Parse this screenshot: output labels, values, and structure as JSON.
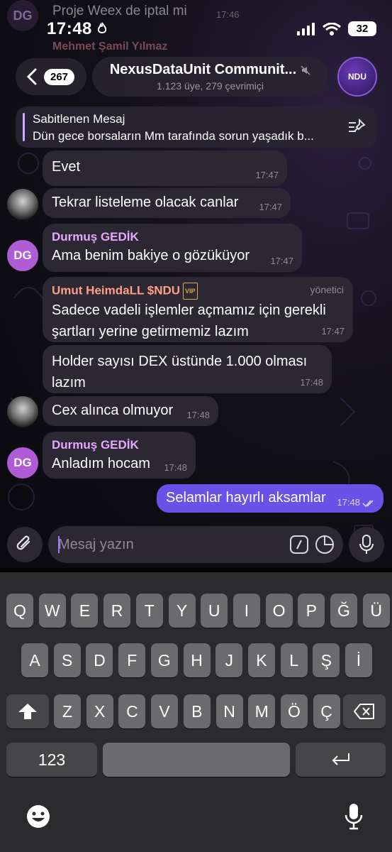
{
  "status_bar": {
    "time": "17:48",
    "battery": "32"
  },
  "peek": {
    "avatar": "DG",
    "text": "Proje Weex de iptal mi",
    "time": "17:46",
    "sender": "Mehmet Şamil Yılmaz"
  },
  "header": {
    "back_count": "267",
    "title": "NexusDataUnit Communit...",
    "subtitle": "1.123 üye, 279 çevrimiçi",
    "avatar_text": "NDU"
  },
  "pinned": {
    "label": "Sabitlenen Mesaj",
    "text": "Dün gece borsaların Mm tarafında sorun yaşadık b..."
  },
  "messages": [
    {
      "text": "Evet",
      "time": "17:47"
    },
    {
      "text": "Tekrar listeleme olacak canlar",
      "time": "17:47"
    },
    {
      "sender": "Durmuş GEDİK",
      "avatar": "DG",
      "text": "Ama benim bakiye o gözüküyor",
      "time": "17:47"
    },
    {
      "sender": "Umut HeimdaLL $NDU",
      "badge": "VIP",
      "role": "yönetici",
      "line1": "Sadece vadeli işlemler açmamız için gerekli",
      "line2": "şartları yerine getirmemiz lazım",
      "time": "17:47"
    },
    {
      "line1": "Holder sayısı DEX üstünde 1.000 olması",
      "line2": "lazım",
      "time": "17:48"
    },
    {
      "text": "Cex alınca olmuyor",
      "time": "17:48"
    },
    {
      "sender": "Durmuş GEDİK",
      "avatar": "DG",
      "text": "Anladım hocam",
      "time": "17:48"
    },
    {
      "text": "Selamlar hayırlı aksamlar",
      "time": "17:48",
      "outgoing": true
    }
  ],
  "composer": {
    "placeholder": "Mesaj yazın"
  },
  "keyboard": {
    "row1": [
      "Q",
      "W",
      "E",
      "R",
      "T",
      "Y",
      "U",
      "I",
      "O",
      "P",
      "Ğ",
      "Ü"
    ],
    "row2": [
      "A",
      "S",
      "D",
      "F",
      "G",
      "H",
      "J",
      "K",
      "L",
      "Ş",
      "İ"
    ],
    "row3": [
      "Z",
      "X",
      "C",
      "V",
      "B",
      "N",
      "M",
      "Ö",
      "Ç"
    ],
    "numbers_label": "123"
  }
}
